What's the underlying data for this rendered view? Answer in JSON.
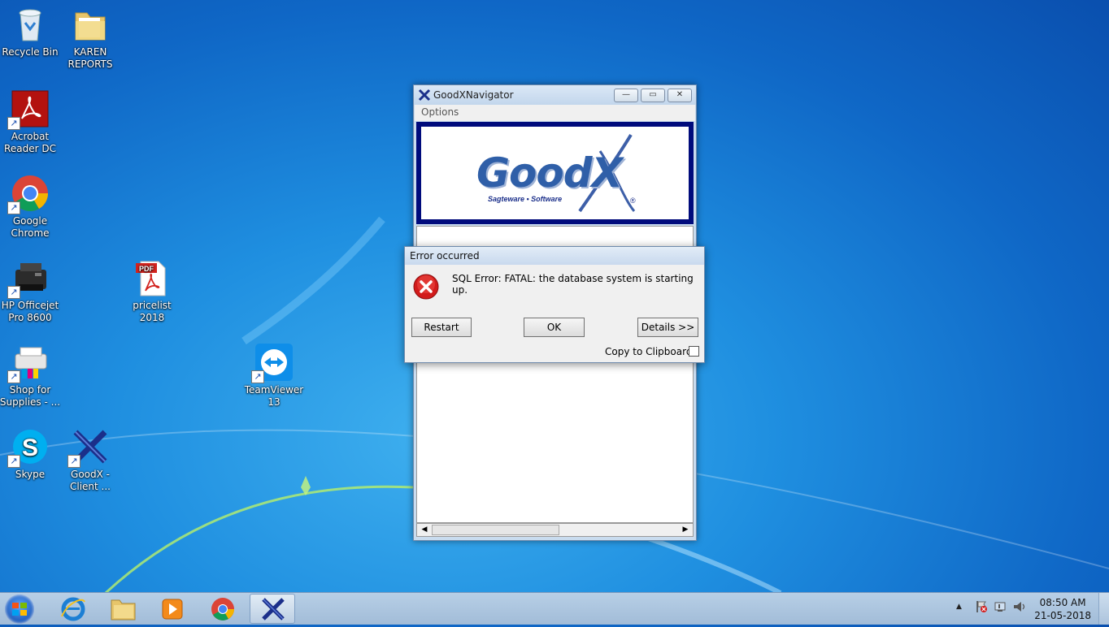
{
  "desktop": {
    "icons": [
      {
        "label": "Recycle Bin",
        "icon": "recycle-bin-icon"
      },
      {
        "label": "KAREN\nREPORTS",
        "icon": "folder-icon"
      },
      {
        "label": "Acrobat\nReader DC",
        "icon": "acrobat-icon"
      },
      {
        "label": "Google\nChrome",
        "icon": "chrome-icon"
      },
      {
        "label": "HP Officejet\nPro 8600",
        "icon": "printer-icon"
      },
      {
        "label": "pricelist 2018",
        "icon": "pdf-file-icon"
      },
      {
        "label": "Shop for\nSupplies - ...",
        "icon": "printer-supplies-icon"
      },
      {
        "label": "TeamViewer\n13",
        "icon": "teamviewer-icon"
      },
      {
        "label": "Skype",
        "icon": "skype-icon"
      },
      {
        "label": "GoodX -\nClient ...",
        "icon": "goodx-icon"
      }
    ]
  },
  "window": {
    "title": "GoodXNavigator",
    "menu": "Options",
    "logo": {
      "brand": "GoodX",
      "tagline": "Sagteware • Software",
      "mark": "®"
    },
    "controls": {
      "minimize": "—",
      "restore": "▭",
      "close": "✕"
    }
  },
  "dialog": {
    "title": "Error occurred",
    "message": "SQL Error: FATAL:  the database system is starting up.",
    "buttons": {
      "restart": "Restart",
      "ok": "OK",
      "details": "Details >>"
    },
    "copy_label": "Copy to Clipboard",
    "copy_checked": false
  },
  "taskbar": {
    "items": [
      "start-orb-icon",
      "internet-explorer-icon",
      "file-explorer-icon",
      "media-player-icon",
      "chrome-icon",
      "goodx-icon"
    ],
    "tray": {
      "arrow": "▲",
      "time": "08:50 AM",
      "date": "21-05-2018"
    }
  },
  "colors": {
    "logo_frame": "#000b7c",
    "logo_text": "#2f5fa8",
    "error_red": "#d21b1b"
  }
}
